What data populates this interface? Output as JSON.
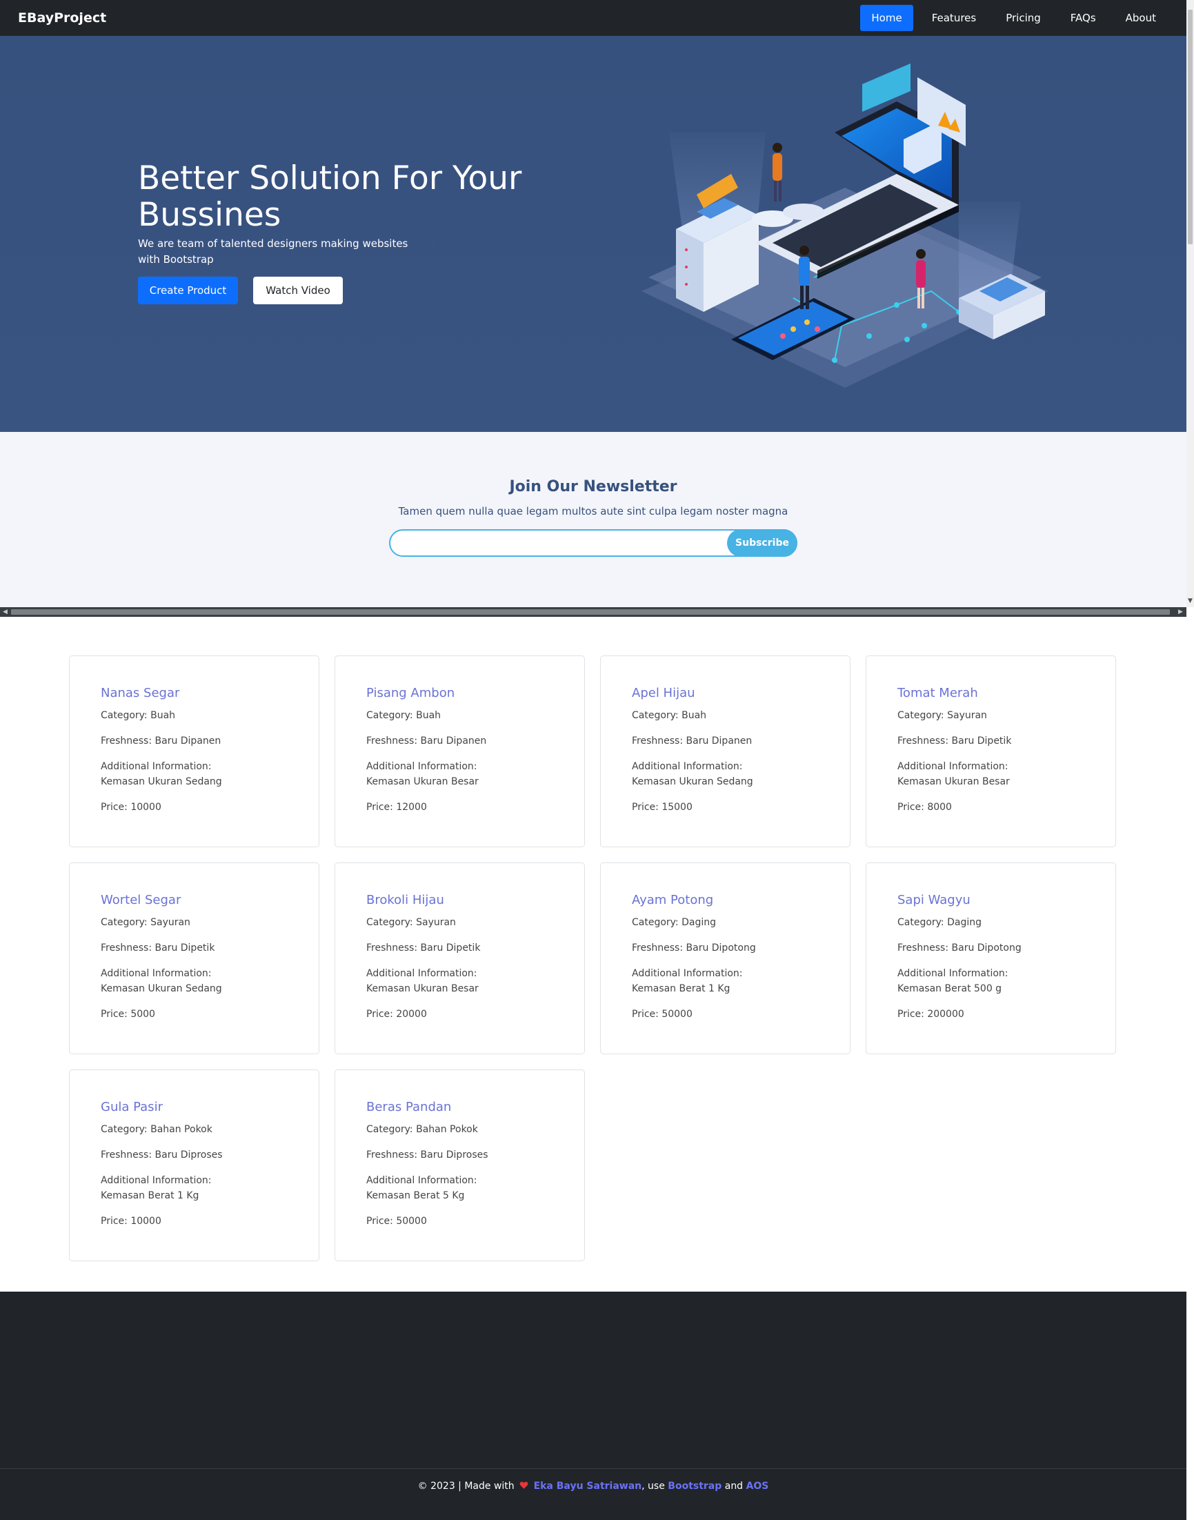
{
  "nav": {
    "brand": "EBayProject",
    "links": [
      "Home",
      "Features",
      "Pricing",
      "FAQs",
      "About"
    ]
  },
  "hero": {
    "title": "Better Solution For Your Bussines",
    "subtitle": "We are team of talented designers making websites with Bootstrap",
    "create_button": "Create Product",
    "watch_button": "Watch Video"
  },
  "newsletter": {
    "title": "Join Our Newsletter",
    "subtitle": "Tamen quem nulla quae legam multos aute sint culpa legam noster magna",
    "input_value": "",
    "subscribe": "Subscribe"
  },
  "products": [
    {
      "name": "Nanas Segar",
      "category": "Category: Buah",
      "freshness": "Freshness: Baru Dipanen",
      "info_label": "Additional Information:",
      "info": "Kemasan Ukuran Sedang",
      "price": "Price: 10000"
    },
    {
      "name": "Pisang Ambon",
      "category": "Category: Buah",
      "freshness": "Freshness: Baru Dipanen",
      "info_label": "Additional Information:",
      "info": "Kemasan Ukuran Besar",
      "price": "Price: 12000"
    },
    {
      "name": "Apel Hijau",
      "category": "Category: Buah",
      "freshness": "Freshness: Baru Dipanen",
      "info_label": "Additional Information:",
      "info": "Kemasan Ukuran Sedang",
      "price": "Price: 15000"
    },
    {
      "name": "Tomat Merah",
      "category": "Category: Sayuran",
      "freshness": "Freshness: Baru Dipetik",
      "info_label": "Additional Information:",
      "info": "Kemasan Ukuran Besar",
      "price": "Price: 8000"
    },
    {
      "name": "Wortel Segar",
      "category": "Category: Sayuran",
      "freshness": "Freshness: Baru Dipetik",
      "info_label": "Additional Information:",
      "info": "Kemasan Ukuran Sedang",
      "price": "Price: 5000"
    },
    {
      "name": "Brokoli Hijau",
      "category": "Category: Sayuran",
      "freshness": "Freshness: Baru Dipetik",
      "info_label": "Additional Information:",
      "info": "Kemasan Ukuran Besar",
      "price": "Price: 20000"
    },
    {
      "name": "Ayam Potong",
      "category": "Category: Daging",
      "freshness": "Freshness: Baru Dipotong",
      "info_label": "Additional Information:",
      "info": "Kemasan Berat 1 Kg",
      "price": "Price: 50000"
    },
    {
      "name": "Sapi Wagyu",
      "category": "Category: Daging",
      "freshness": "Freshness: Baru Dipotong",
      "info_label": "Additional Information:",
      "info": "Kemasan Berat 500 g",
      "price": "Price: 200000"
    },
    {
      "name": "Gula Pasir",
      "category": "Category: Bahan Pokok",
      "freshness": "Freshness: Baru Diproses",
      "info_label": "Additional Information:",
      "info": "Kemasan Berat 1 Kg",
      "price": "Price: 10000"
    },
    {
      "name": "Beras Pandan",
      "category": "Category: Bahan Pokok",
      "freshness": "Freshness: Baru Diproses",
      "info_label": "Additional Information:",
      "info": "Kemasan Berat 5 Kg",
      "price": "Price: 50000"
    }
  ],
  "footer": {
    "prefix": "© 2023 | Made with",
    "author": "Eka Bayu Satriawan",
    "use": ", use",
    "bootstrap": "Bootstrap",
    "and": "and",
    "aos": "AOS",
    "heart_icon": "heart-icon",
    "heart_color": "#e5383b"
  },
  "colors": {
    "hero_bg": "#37517e",
    "accent": "#0d6efd",
    "newsletter_accent": "#47b2e4",
    "card_title": "#6a72d5",
    "dark": "#212529"
  }
}
